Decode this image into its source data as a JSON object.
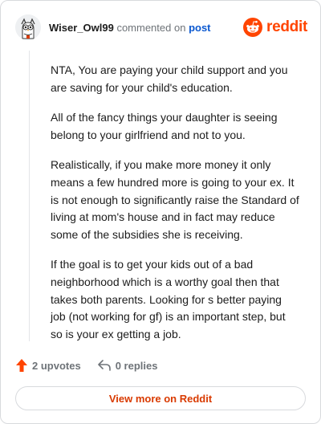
{
  "comment": {
    "author": "Wiser_Owl99",
    "action_text": "commented on",
    "post_link_text": "post",
    "avatar_icon": "owl-avatar-icon",
    "paragraphs": [
      "NTA, You are paying your child support and you are saving for your child's education.",
      "All of the fancy things your daughter is seeing belong to your girlfriend and not to you.",
      "Realistically, if you make more money it only means a few hundred more is going to your ex. It is not enough to significantly raise the Standard of living at mom's house and in fact may reduce some of the subsidies she is receiving.",
      "If the goal is to get your kids out of a bad neighborhood which is a worthy goal then that takes both parents. Looking for s better paying job (not working for gf) is an important step, but so is your ex getting a job."
    ]
  },
  "brand": {
    "wordmark": "reddit",
    "icon": "reddit-snoo-icon",
    "color": "#ff4500"
  },
  "actions": {
    "upvotes": "2 upvotes",
    "replies": "0 replies",
    "upvote_icon": "upvote-arrow-icon",
    "reply_icon": "reply-arrow-icon",
    "upvote_color": "#ff4500"
  },
  "footer": {
    "view_more_label": "View more on Reddit",
    "link_color": "#d93a00"
  }
}
